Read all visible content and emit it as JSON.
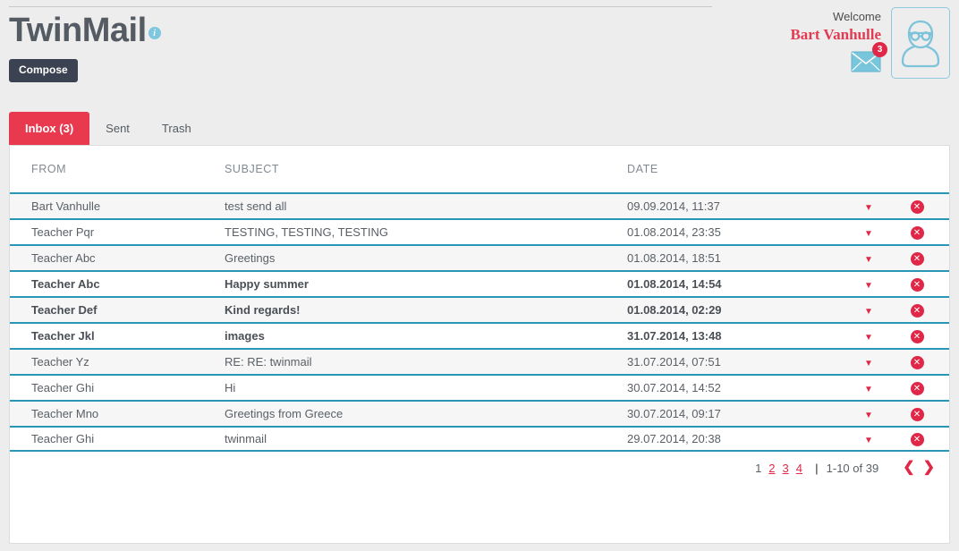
{
  "app": {
    "brand_title": "TwinMail",
    "info_icon": "info-icon",
    "compose_label": "Compose"
  },
  "user": {
    "welcome_label": "Welcome",
    "name": "Bart Vanhulle",
    "unread_badge": "3",
    "mail_icon": "envelope-icon",
    "avatar_icon": "user-avatar-icon"
  },
  "tabs": [
    {
      "label": "Inbox (3)",
      "active": true
    },
    {
      "label": "Sent",
      "active": false
    },
    {
      "label": "Trash",
      "active": false
    }
  ],
  "table": {
    "headers": {
      "from": "FROM",
      "subject": "SUBJECT",
      "date": "DATE"
    },
    "rows": [
      {
        "from": "Bart Vanhulle",
        "subject": "test send all",
        "date": "09.09.2014, 11:37",
        "unread": false
      },
      {
        "from": "Teacher Pqr",
        "subject": "TESTING, TESTING, TESTING",
        "date": "01.08.2014, 23:35",
        "unread": false
      },
      {
        "from": "Teacher Abc",
        "subject": "Greetings",
        "date": "01.08.2014, 18:51",
        "unread": false
      },
      {
        "from": "Teacher Abc",
        "subject": "Happy summer",
        "date": "01.08.2014, 14:54",
        "unread": true
      },
      {
        "from": "Teacher Def",
        "subject": "Kind regards!",
        "date": "01.08.2014, 02:29",
        "unread": true
      },
      {
        "from": "Teacher Jkl",
        "subject": "images",
        "date": "31.07.2014, 13:48",
        "unread": true
      },
      {
        "from": "Teacher Yz",
        "subject": "RE: RE: twinmail",
        "date": "31.07.2014, 07:51",
        "unread": false
      },
      {
        "from": "Teacher Ghi",
        "subject": "Hi",
        "date": "30.07.2014, 14:52",
        "unread": false
      },
      {
        "from": "Teacher Mno",
        "subject": "Greetings from Greece",
        "date": "30.07.2014, 09:17",
        "unread": false
      },
      {
        "from": "Teacher Ghi",
        "subject": "twinmail",
        "date": "29.07.2014, 20:38",
        "unread": false
      }
    ],
    "row_caret": "▼",
    "row_delete": "✕"
  },
  "pagination": {
    "pages": [
      {
        "label": "1",
        "current": true
      },
      {
        "label": "2",
        "current": false
      },
      {
        "label": "3",
        "current": false
      },
      {
        "label": "4",
        "current": false
      }
    ],
    "separator": "|",
    "range": "1-10 of 39",
    "prev": "❮",
    "next": "❯"
  },
  "colors": {
    "accent_red": "#e02747",
    "tab_red": "#e8394f",
    "teal_rule": "#2a96b6",
    "dark_navy": "#3b4251",
    "light_blue": "#7ec7de"
  }
}
